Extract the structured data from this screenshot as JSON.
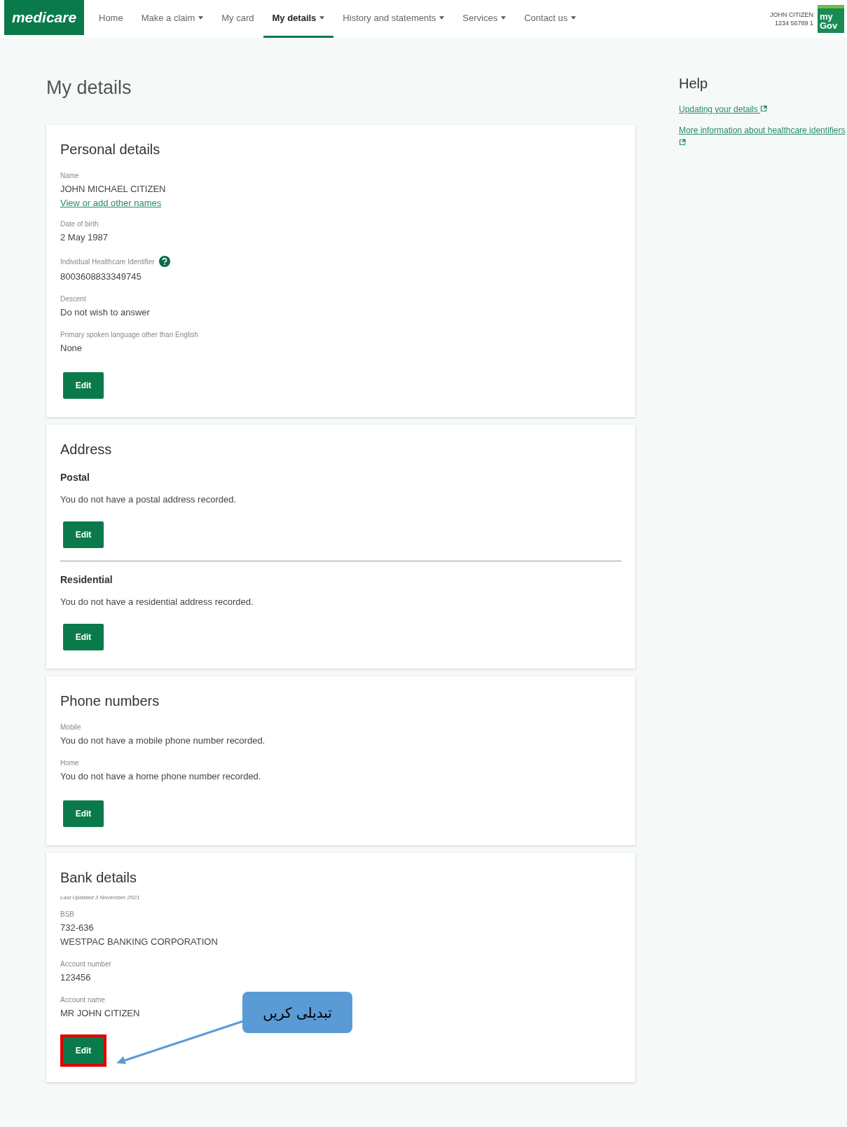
{
  "header": {
    "logo": "medicare",
    "nav": [
      {
        "label": "Home",
        "dropdown": false,
        "selected": false
      },
      {
        "label": "Make a claim",
        "dropdown": true,
        "selected": false
      },
      {
        "label": "My card",
        "dropdown": false,
        "selected": false
      },
      {
        "label": "My details",
        "dropdown": true,
        "selected": true
      },
      {
        "label": "History and statements",
        "dropdown": true,
        "selected": false
      },
      {
        "label": "Services",
        "dropdown": true,
        "selected": false
      },
      {
        "label": "Contact us",
        "dropdown": true,
        "selected": false
      }
    ],
    "user": {
      "name": "JOHN CITIZEN",
      "number": "1234 56789 1"
    },
    "mygov": [
      "my",
      "Gov"
    ]
  },
  "page_title": "My details",
  "sections": [
    {
      "title": "Personal details",
      "groups": [
        {
          "fields": [
            {
              "label": "Name",
              "values": [
                "JOHN MICHAEL CITIZEN"
              ],
              "link": "View or add other names"
            },
            {
              "label": "Date of birth",
              "values": [
                "2 May 1987"
              ]
            },
            {
              "label": "Individual Healthcare Identifier",
              "help": true,
              "values": [
                "8003608833349745"
              ]
            },
            {
              "label": "Descent",
              "values": [
                "Do not wish to answer"
              ]
            },
            {
              "label": "Primary spoken language other than English",
              "values": [
                "None"
              ]
            }
          ],
          "button": {
            "label": "Edit",
            "highlighted": false
          }
        }
      ]
    },
    {
      "title": "Address",
      "groups": [
        {
          "subtitle": "Postal",
          "text": "You do not have a postal address recorded.",
          "button": {
            "label": "Edit",
            "highlighted": false
          }
        },
        {
          "subtitle": "Residential",
          "text": "You do not have a residential address recorded.",
          "button": {
            "label": "Edit",
            "highlighted": false
          }
        }
      ]
    },
    {
      "title": "Phone numbers",
      "groups": [
        {
          "fields": [
            {
              "label": "Mobile",
              "values": [
                "You do not have a mobile phone number recorded."
              ]
            },
            {
              "label": "Home",
              "values": [
                "You do not have a home phone number recorded."
              ]
            }
          ],
          "button": {
            "label": "Edit",
            "highlighted": false
          }
        }
      ]
    },
    {
      "title": "Bank details",
      "note": "Last Updated 3 November 2021",
      "groups": [
        {
          "fields": [
            {
              "label": "BSB",
              "values": [
                "732-636",
                "WESTPAC BANKING CORPORATION"
              ]
            },
            {
              "label": "Account number",
              "values": [
                "123456"
              ]
            },
            {
              "label": "Account name",
              "values": [
                "MR JOHN CITIZEN"
              ]
            }
          ],
          "button": {
            "label": "Edit",
            "highlighted": true
          }
        }
      ]
    }
  ],
  "help": {
    "title": "Help",
    "links": [
      "Updating your details",
      "More information about healthcare identifiers"
    ]
  },
  "annotation": {
    "text": "تبدیلی کریں"
  }
}
